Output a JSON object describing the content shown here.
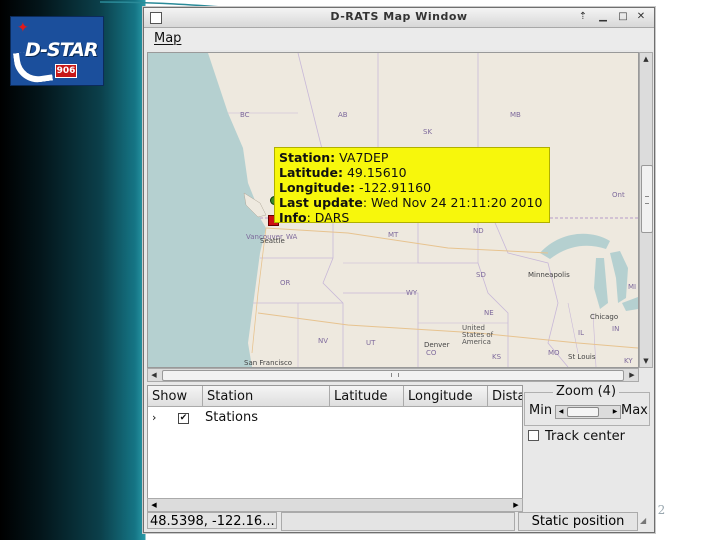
{
  "slide": {
    "page_number": "12",
    "logo_text": "D-STAR",
    "logo_badge": "906"
  },
  "window": {
    "title": "D-RATS Map Window",
    "buttons": {
      "up": "⇡",
      "minimize": "▁",
      "maximize": "□",
      "close": "✕"
    }
  },
  "menu": {
    "map": "Map"
  },
  "map": {
    "labels": {
      "bc": "BC",
      "ab": "AB",
      "sk": "SK",
      "mb": "MB",
      "ont": "Ont",
      "wa": "WA",
      "mt": "MT",
      "nd": "ND",
      "or": "OR",
      "sd": "SD",
      "wy": "WY",
      "ne": "NE",
      "nv": "NV",
      "ut": "UT",
      "co": "CO",
      "ks": "KS",
      "mo": "MO",
      "il": "IL",
      "mi": "MI",
      "ny": "NY",
      "ky": "KY",
      "in": "IN",
      "seattle": "Seattle",
      "vancouver": "Vancouver",
      "minneapolis": "Minneapolis",
      "chicago": "Chicago",
      "denver": "Denver",
      "san_francisco": "San Francisco",
      "st_louis": "St Louis",
      "united_states": "United States of America"
    }
  },
  "popup": {
    "station_key": "Station:",
    "station": "VA7DEP",
    "latitude_key": "Latitude:",
    "latitude": "49.15610",
    "longitude_key": "Longitude:",
    "longitude": "-122.91160",
    "last_update_key": "Last update",
    "last_update": "Wed Nov 24 21:11:20 2010",
    "info_key": "Info",
    "info": "DARS"
  },
  "table": {
    "headers": {
      "show": "Show",
      "station": "Station",
      "latitude": "Latitude",
      "longitude": "Longitude",
      "distance": "Dista"
    },
    "row": {
      "expander": "›",
      "checked": "✔",
      "label": "Stations"
    }
  },
  "zoom": {
    "title": "Zoom (4)",
    "min": "Min",
    "max": "Max",
    "level": 4
  },
  "track_center": {
    "label": "Track center",
    "checked": false
  },
  "status": {
    "coords": "48.5398, -122.16...",
    "button": "Static position"
  },
  "colors": {
    "popup": "#f7f70c",
    "marker": "#cc1111",
    "map_land": "#eee9df",
    "water": "#b5d0d0"
  }
}
